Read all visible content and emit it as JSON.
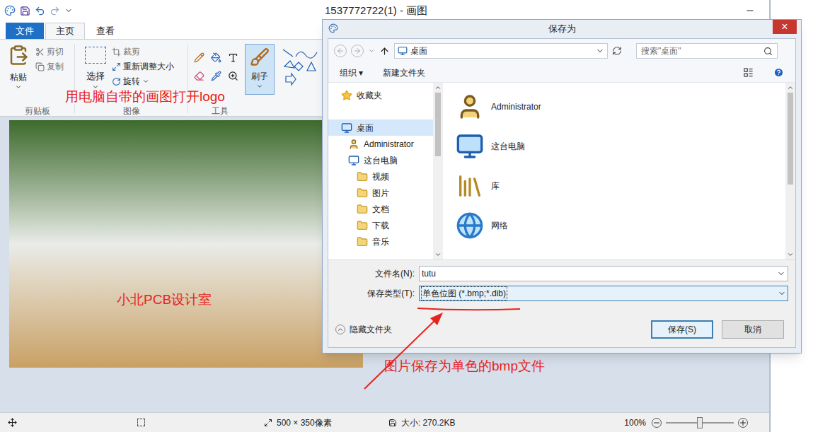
{
  "paint": {
    "title": "1537772722(1) - 画图",
    "tabs": [
      {
        "label": "文件",
        "selected": false,
        "kind": "file"
      },
      {
        "label": "主页",
        "selected": true,
        "kind": "tab"
      },
      {
        "label": "查看",
        "selected": false,
        "kind": "tab"
      }
    ],
    "ribbon": {
      "paste": "粘贴",
      "cut": "剪切",
      "copy": "复制",
      "select": "选择",
      "crop": "裁剪",
      "resize": "重新调整大小",
      "rotate": "旋转",
      "brush": "刷子",
      "groups": [
        "剪贴板",
        "图像",
        "工具"
      ]
    },
    "status": {
      "size": "500 × 350像素",
      "file_size": "大小: 270.2KB",
      "zoom": "100%",
      "zoom_level": 0.5
    }
  },
  "annotations": {
    "open": "用电脑自带的画图打开logo",
    "watermark": "小北PCB设计室",
    "save_hint": "图片保存为单色的bmp文件"
  },
  "dialog": {
    "title": "保存为",
    "close": "×",
    "address": "桌面",
    "search_placeholder": "搜索\"桌面\"",
    "toolbar": {
      "organize": "组织 ▾",
      "new_folder": "新建文件夹"
    },
    "nav": [
      {
        "label": "收藏夹",
        "kind": "favorites",
        "selected": false
      },
      {
        "label": "桌面",
        "kind": "desktop",
        "selected": true
      },
      {
        "label": "Administrator",
        "kind": "user",
        "selected": false
      },
      {
        "label": "这台电脑",
        "kind": "pc",
        "selected": false
      },
      {
        "label": "视频",
        "kind": "folder",
        "selected": false
      },
      {
        "label": "图片",
        "kind": "folder",
        "selected": false
      },
      {
        "label": "文档",
        "kind": "folder",
        "selected": false
      },
      {
        "label": "下载",
        "kind": "folder",
        "selected": false
      },
      {
        "label": "音乐",
        "kind": "folder",
        "selected": false
      }
    ],
    "items": [
      {
        "label": "Administrator",
        "kind": "user"
      },
      {
        "label": "这台电脑",
        "kind": "pc"
      },
      {
        "label": "库",
        "kind": "library"
      },
      {
        "label": "网络",
        "kind": "network"
      }
    ],
    "file_name_label": "文件名(N):",
    "file_name": "tutu",
    "type_label": "保存类型(T):",
    "type_value": "单色位图 (*.bmp;*.dib)",
    "hide_folders": "隐藏文件夹",
    "save": "保存(S)",
    "cancel": "取消"
  }
}
